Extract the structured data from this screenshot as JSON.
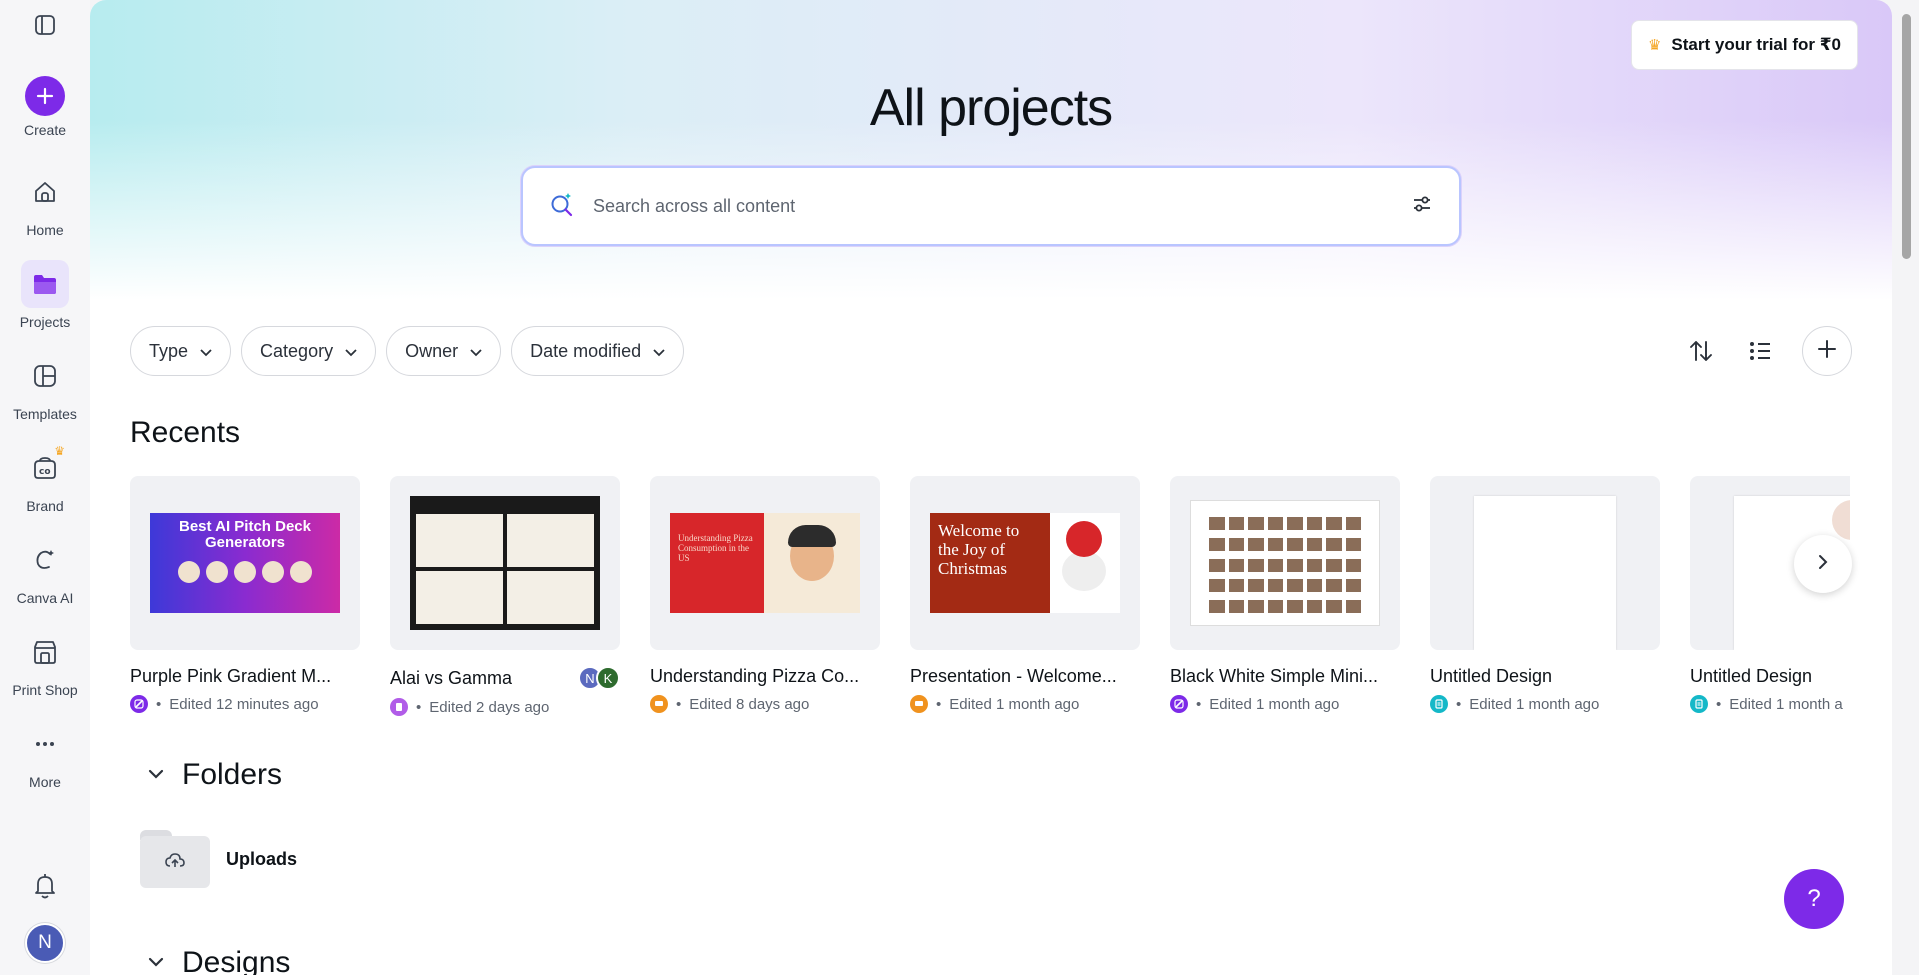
{
  "rail": {
    "create_label": "Create",
    "items": [
      {
        "label": "Home",
        "icon": "home-icon"
      },
      {
        "label": "Projects",
        "icon": "folder-icon",
        "active": true
      },
      {
        "label": "Templates",
        "icon": "templates-icon"
      },
      {
        "label": "Brand",
        "icon": "brand-icon",
        "crown": true
      },
      {
        "label": "Canva AI",
        "icon": "canva-ai-icon"
      },
      {
        "label": "Print Shop",
        "icon": "print-shop-icon"
      },
      {
        "label": "More",
        "icon": "more-icon"
      }
    ],
    "avatar_initial": "N"
  },
  "header": {
    "trial_label": "Start your trial for ₹0",
    "title": "All projects"
  },
  "search": {
    "placeholder": "Search across all content"
  },
  "filters": [
    "Type",
    "Category",
    "Owner",
    "Date modified"
  ],
  "recents": {
    "title": "Recents",
    "items": [
      {
        "title": "Purple Pink Gradient M...",
        "meta": "Edited 12 minutes ago",
        "badge_color": "#7d2ae8",
        "thumb_text": "Best AI Pitch Deck Generators"
      },
      {
        "title": "Alai vs Gamma",
        "meta": "Edited 2 days ago",
        "badge_color": "#b15ce8",
        "collaborators": [
          {
            "initial": "N",
            "color": "#5b6abf"
          },
          {
            "initial": "K",
            "color": "#2e6b2e"
          }
        ]
      },
      {
        "title": "Understanding Pizza Co...",
        "meta": "Edited 8 days ago",
        "badge_color": "#f0921e",
        "thumb_text": "Understanding Pizza Consumption in the US"
      },
      {
        "title": "Presentation - Welcome...",
        "meta": "Edited 1 month ago",
        "badge_color": "#f0921e",
        "thumb_text": "Welcome to the Joy of Christmas"
      },
      {
        "title": "Black White Simple Mini...",
        "meta": "Edited 1 month ago",
        "badge_color": "#7d2ae8"
      },
      {
        "title": "Untitled Design",
        "meta": "Edited 1 month ago",
        "badge_color": "#14b8c8"
      },
      {
        "title": "Untitled Design",
        "meta": "Edited 1 month a",
        "badge_color": "#14b8c8"
      }
    ]
  },
  "folders": {
    "title": "Folders",
    "items": [
      {
        "label": "Uploads"
      }
    ]
  },
  "designs": {
    "title": "Designs"
  },
  "help_label": "?"
}
